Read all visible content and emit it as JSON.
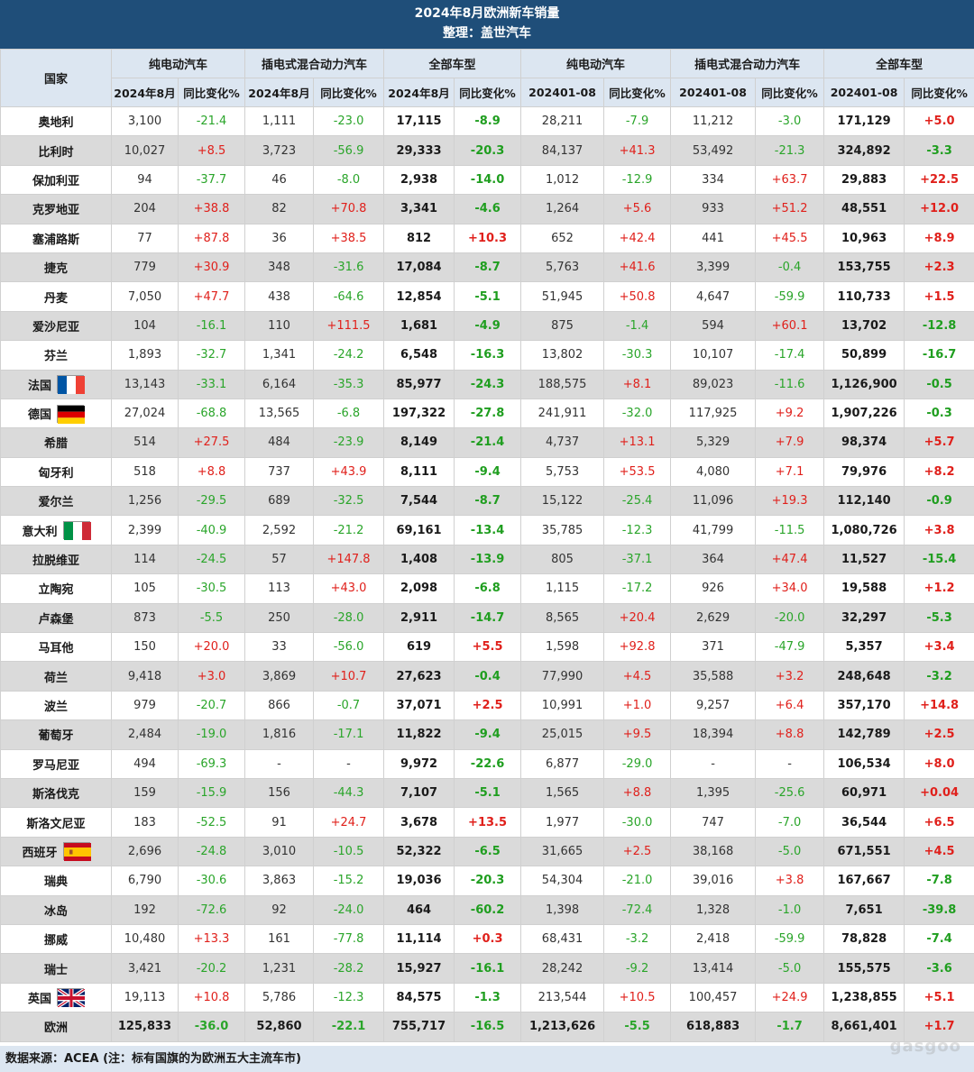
{
  "title": "2024年8月欧洲新车销量",
  "subtitle": "整理：盖世汽车",
  "header": {
    "country": "国家",
    "groups": [
      "纯电动汽车",
      "插电式混合动力汽车",
      "全部车型",
      "纯电动汽车",
      "插电式混合动力汽车",
      "全部车型"
    ],
    "sub": [
      "2024年8月",
      "同比变化%",
      "2024年8月",
      "同比变化%",
      "2024年8月",
      "同比变化%",
      "202401-08",
      "同比变化%",
      "202401-08",
      "同比变化%",
      "202401-08",
      "同比变化%"
    ]
  },
  "rows": [
    {
      "country": "奥地利",
      "v": [
        "3,100",
        "-21.4",
        "1,111",
        "-23.0",
        "17,115",
        "-8.9",
        "28,211",
        "-7.9",
        "11,212",
        "-3.0",
        "171,129",
        "+5.0"
      ]
    },
    {
      "country": "比利时",
      "v": [
        "10,027",
        "+8.5",
        "3,723",
        "-56.9",
        "29,333",
        "-20.3",
        "84,137",
        "+41.3",
        "53,492",
        "-21.3",
        "324,892",
        "-3.3"
      ]
    },
    {
      "country": "保加利亚",
      "v": [
        "94",
        "-37.7",
        "46",
        "-8.0",
        "2,938",
        "-14.0",
        "1,012",
        "-12.9",
        "334",
        "+63.7",
        "29,883",
        "+22.5"
      ]
    },
    {
      "country": "克罗地亚",
      "v": [
        "204",
        "+38.8",
        "82",
        "+70.8",
        "3,341",
        "-4.6",
        "1,264",
        "+5.6",
        "933",
        "+51.2",
        "48,551",
        "+12.0"
      ]
    },
    {
      "country": "塞浦路斯",
      "v": [
        "77",
        "+87.8",
        "36",
        "+38.5",
        "812",
        "+10.3",
        "652",
        "+42.4",
        "441",
        "+45.5",
        "10,963",
        "+8.9"
      ]
    },
    {
      "country": "捷克",
      "v": [
        "779",
        "+30.9",
        "348",
        "-31.6",
        "17,084",
        "-8.7",
        "5,763",
        "+41.6",
        "3,399",
        "-0.4",
        "153,755",
        "+2.3"
      ]
    },
    {
      "country": "丹麦",
      "v": [
        "7,050",
        "+47.7",
        "438",
        "-64.6",
        "12,854",
        "-5.1",
        "51,945",
        "+50.8",
        "4,647",
        "-59.9",
        "110,733",
        "+1.5"
      ]
    },
    {
      "country": "爱沙尼亚",
      "v": [
        "104",
        "-16.1",
        "110",
        "+111.5",
        "1,681",
        "-4.9",
        "875",
        "-1.4",
        "594",
        "+60.1",
        "13,702",
        "-12.8"
      ]
    },
    {
      "country": "芬兰",
      "v": [
        "1,893",
        "-32.7",
        "1,341",
        "-24.2",
        "6,548",
        "-16.3",
        "13,802",
        "-30.3",
        "10,107",
        "-17.4",
        "50,899",
        "-16.7"
      ]
    },
    {
      "country": "法国",
      "flag": "fr",
      "v": [
        "13,143",
        "-33.1",
        "6,164",
        "-35.3",
        "85,977",
        "-24.3",
        "188,575",
        "+8.1",
        "89,023",
        "-11.6",
        "1,126,900",
        "-0.5"
      ]
    },
    {
      "country": "德国",
      "flag": "de",
      "v": [
        "27,024",
        "-68.8",
        "13,565",
        "-6.8",
        "197,322",
        "-27.8",
        "241,911",
        "-32.0",
        "117,925",
        "+9.2",
        "1,907,226",
        "-0.3"
      ]
    },
    {
      "country": "希腊",
      "v": [
        "514",
        "+27.5",
        "484",
        "-23.9",
        "8,149",
        "-21.4",
        "4,737",
        "+13.1",
        "5,329",
        "+7.9",
        "98,374",
        "+5.7"
      ]
    },
    {
      "country": "匈牙利",
      "v": [
        "518",
        "+8.8",
        "737",
        "+43.9",
        "8,111",
        "-9.4",
        "5,753",
        "+53.5",
        "4,080",
        "+7.1",
        "79,976",
        "+8.2"
      ]
    },
    {
      "country": "爱尔兰",
      "v": [
        "1,256",
        "-29.5",
        "689",
        "-32.5",
        "7,544",
        "-8.7",
        "15,122",
        "-25.4",
        "11,096",
        "+19.3",
        "112,140",
        "-0.9"
      ]
    },
    {
      "country": "意大利",
      "flag": "it",
      "v": [
        "2,399",
        "-40.9",
        "2,592",
        "-21.2",
        "69,161",
        "-13.4",
        "35,785",
        "-12.3",
        "41,799",
        "-11.5",
        "1,080,726",
        "+3.8"
      ]
    },
    {
      "country": "拉脱维亚",
      "v": [
        "114",
        "-24.5",
        "57",
        "+147.8",
        "1,408",
        "-13.9",
        "805",
        "-37.1",
        "364",
        "+47.4",
        "11,527",
        "-15.4"
      ]
    },
    {
      "country": "立陶宛",
      "v": [
        "105",
        "-30.5",
        "113",
        "+43.0",
        "2,098",
        "-6.8",
        "1,115",
        "-17.2",
        "926",
        "+34.0",
        "19,588",
        "+1.2"
      ]
    },
    {
      "country": "卢森堡",
      "v": [
        "873",
        "-5.5",
        "250",
        "-28.0",
        "2,911",
        "-14.7",
        "8,565",
        "+20.4",
        "2,629",
        "-20.0",
        "32,297",
        "-5.3"
      ]
    },
    {
      "country": "马耳他",
      "v": [
        "150",
        "+20.0",
        "33",
        "-56.0",
        "619",
        "+5.5",
        "1,598",
        "+92.8",
        "371",
        "-47.9",
        "5,357",
        "+3.4"
      ]
    },
    {
      "country": "荷兰",
      "v": [
        "9,418",
        "+3.0",
        "3,869",
        "+10.7",
        "27,623",
        "-0.4",
        "77,990",
        "+4.5",
        "35,588",
        "+3.2",
        "248,648",
        "-3.2"
      ]
    },
    {
      "country": "波兰",
      "v": [
        "979",
        "-20.7",
        "866",
        "-0.7",
        "37,071",
        "+2.5",
        "10,991",
        "+1.0",
        "9,257",
        "+6.4",
        "357,170",
        "+14.8"
      ]
    },
    {
      "country": "葡萄牙",
      "v": [
        "2,484",
        "-19.0",
        "1,816",
        "-17.1",
        "11,822",
        "-9.4",
        "25,015",
        "+9.5",
        "18,394",
        "+8.8",
        "142,789",
        "+2.5"
      ]
    },
    {
      "country": "罗马尼亚",
      "v": [
        "494",
        "-69.3",
        "-",
        "-",
        "9,972",
        "-22.6",
        "6,877",
        "-29.0",
        "-",
        "-",
        "106,534",
        "+8.0"
      ]
    },
    {
      "country": "斯洛伐克",
      "v": [
        "159",
        "-15.9",
        "156",
        "-44.3",
        "7,107",
        "-5.1",
        "1,565",
        "+8.8",
        "1,395",
        "-25.6",
        "60,971",
        "+0.04"
      ]
    },
    {
      "country": "斯洛文尼亚",
      "v": [
        "183",
        "-52.5",
        "91",
        "+24.7",
        "3,678",
        "+13.5",
        "1,977",
        "-30.0",
        "747",
        "-7.0",
        "36,544",
        "+6.5"
      ]
    },
    {
      "country": "西班牙",
      "flag": "es",
      "v": [
        "2,696",
        "-24.8",
        "3,010",
        "-10.5",
        "52,322",
        "-6.5",
        "31,665",
        "+2.5",
        "38,168",
        "-5.0",
        "671,551",
        "+4.5"
      ]
    },
    {
      "country": "瑞典",
      "v": [
        "6,790",
        "-30.6",
        "3,863",
        "-15.2",
        "19,036",
        "-20.3",
        "54,304",
        "-21.0",
        "39,016",
        "+3.8",
        "167,667",
        "-7.8"
      ]
    },
    {
      "country": "冰岛",
      "v": [
        "192",
        "-72.6",
        "92",
        "-24.0",
        "464",
        "-60.2",
        "1,398",
        "-72.4",
        "1,328",
        "-1.0",
        "7,651",
        "-39.8"
      ]
    },
    {
      "country": "挪威",
      "v": [
        "10,480",
        "+13.3",
        "161",
        "-77.8",
        "11,114",
        "+0.3",
        "68,431",
        "-3.2",
        "2,418",
        "-59.9",
        "78,828",
        "-7.4"
      ]
    },
    {
      "country": "瑞士",
      "v": [
        "3,421",
        "-20.2",
        "1,231",
        "-28.2",
        "15,927",
        "-16.1",
        "28,242",
        "-9.2",
        "13,414",
        "-5.0",
        "155,575",
        "-3.6"
      ]
    },
    {
      "country": "英国",
      "flag": "gb",
      "v": [
        "19,113",
        "+10.8",
        "5,786",
        "-12.3",
        "84,575",
        "-1.3",
        "213,544",
        "+10.5",
        "100,457",
        "+24.9",
        "1,238,855",
        "+5.1"
      ]
    }
  ],
  "total": {
    "country": "欧洲",
    "v": [
      "125,833",
      "-36.0",
      "52,860",
      "-22.1",
      "755,717",
      "-16.5",
      "1,213,626",
      "-5.5",
      "618,883",
      "-1.7",
      "8,661,401",
      "+1.7"
    ]
  },
  "footer": "数据来源：ACEA (注：标有国旗的为欧洲五大主流车市)",
  "colors": {
    "header_bg": "#1f4e79",
    "subheader_bg": "#dce6f1",
    "positive": "#e0201b",
    "negative": "#2aa52a",
    "stripe": "#dadada"
  }
}
